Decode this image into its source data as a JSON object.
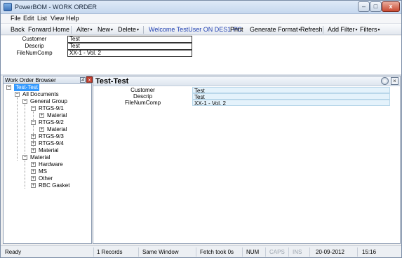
{
  "window": {
    "title": "PowerBOM - WORK ORDER",
    "minimize_label": "–",
    "maximize_label": "□",
    "close_label": "x"
  },
  "menu": [
    "File",
    "Edit",
    "List",
    "View",
    "Help"
  ],
  "toolbar": {
    "back": "Back",
    "forward": "Forward",
    "home": "Home",
    "alter": "Alter",
    "new": "New",
    "delete": "Delete",
    "welcome": "Welcome TestUser ON DES1-PC",
    "print": "Print",
    "generate_format": "Generate Format",
    "refresh": "Refresh",
    "add_filter": "Add Filter",
    "filters": "Filters",
    "caret": "▾"
  },
  "header_form": {
    "fields": [
      {
        "label": "Customer",
        "value": "Test"
      },
      {
        "label": "Descrip",
        "value": "Test"
      },
      {
        "label": "FileNumComp",
        "value": "XX-1 - Vol. 2"
      }
    ]
  },
  "browser": {
    "title": "Work Order Browser",
    "pin_label": "⊿",
    "close_label": "x",
    "tree": [
      {
        "label": "Test-Test",
        "toggle": "−"
      },
      {
        "label": "All Documents",
        "toggle": "−"
      },
      {
        "label": "General Group",
        "toggle": "−"
      },
      {
        "label": "RTGS-9/1",
        "toggle": "−"
      },
      {
        "label": "Material",
        "toggle": "+"
      },
      {
        "label": "RTGS-9/2",
        "toggle": "−"
      },
      {
        "label": "Material",
        "toggle": "+"
      },
      {
        "label": "RTGS-9/3",
        "toggle": "+"
      },
      {
        "label": "RTGS-9/4",
        "toggle": "+"
      },
      {
        "label": "Material",
        "toggle": "+"
      },
      {
        "label": "Material",
        "toggle": "−"
      },
      {
        "label": "Hardware",
        "toggle": "+"
      },
      {
        "label": "MS",
        "toggle": "+"
      },
      {
        "label": "Other",
        "toggle": "+"
      },
      {
        "label": "RBC Gasket",
        "toggle": "+"
      }
    ]
  },
  "detail": {
    "title": "Test-Test",
    "close_label": "×",
    "rows": [
      {
        "label": "Customer",
        "value": "Test"
      },
      {
        "label": "Descrip",
        "value": "Test"
      },
      {
        "label": "FileNumComp",
        "value": "XX-1 - Vol. 2"
      }
    ]
  },
  "status": {
    "ready": "Ready",
    "records": "1 Records",
    "window_mode": "Same Window",
    "fetch": "Fetch took 0s",
    "num": "NUM",
    "caps": "CAPS",
    "ins": "INS",
    "date": "20-09-2012",
    "time": "15:16"
  },
  "colors": {
    "selection": "#3399ff",
    "welcome_text": "#1f3fb0",
    "detail_value_bg": "#e4f2fb"
  }
}
